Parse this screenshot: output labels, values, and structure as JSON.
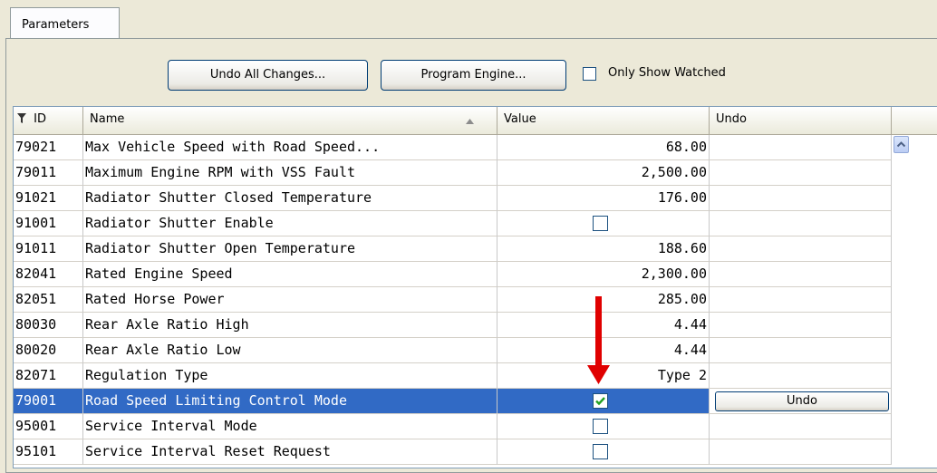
{
  "tab_label": "Parameters",
  "toolbar": {
    "undo_all_label": "Undo All Changes...",
    "program_engine_label": "Program Engine...",
    "only_show_watched_label": "Only Show Watched",
    "only_show_watched_checked": false
  },
  "columns": {
    "id": "ID",
    "name": "Name",
    "value": "Value",
    "undo": "Undo"
  },
  "rows": [
    {
      "id": "79021",
      "name": "Max Vehicle Speed with Road Speed...",
      "value": "68.00"
    },
    {
      "id": "79011",
      "name": "Maximum Engine RPM with VSS Fault",
      "value": "2,500.00"
    },
    {
      "id": "91021",
      "name": "Radiator Shutter Closed Temperature",
      "value": "176.00"
    },
    {
      "id": "91001",
      "name": "Radiator Shutter Enable",
      "value": "",
      "checkbox": true,
      "checked": false
    },
    {
      "id": "91011",
      "name": "Radiator Shutter Open Temperature",
      "value": "188.60"
    },
    {
      "id": "82041",
      "name": "Rated Engine Speed",
      "value": "2,300.00"
    },
    {
      "id": "82051",
      "name": "Rated Horse Power",
      "value": "285.00"
    },
    {
      "id": "80030",
      "name": "Rear Axle Ratio High",
      "value": "4.44"
    },
    {
      "id": "80020",
      "name": "Rear Axle Ratio Low",
      "value": "4.44"
    },
    {
      "id": "82071",
      "name": "Regulation Type",
      "value": "Type 2"
    },
    {
      "id": "79001",
      "name": "Road Speed Limiting Control Mode",
      "value": "",
      "checkbox": true,
      "checked": true,
      "selected": true,
      "undo": "Undo"
    },
    {
      "id": "95001",
      "name": "Service Interval Mode",
      "value": "",
      "checkbox": true,
      "checked": false
    },
    {
      "id": "95101",
      "name": "Service Interval Reset Request",
      "value": "",
      "checkbox": true,
      "checked": false
    }
  ],
  "colors": {
    "selection": "#316ac5",
    "arrow": "#e00000",
    "check": "#21a121"
  }
}
